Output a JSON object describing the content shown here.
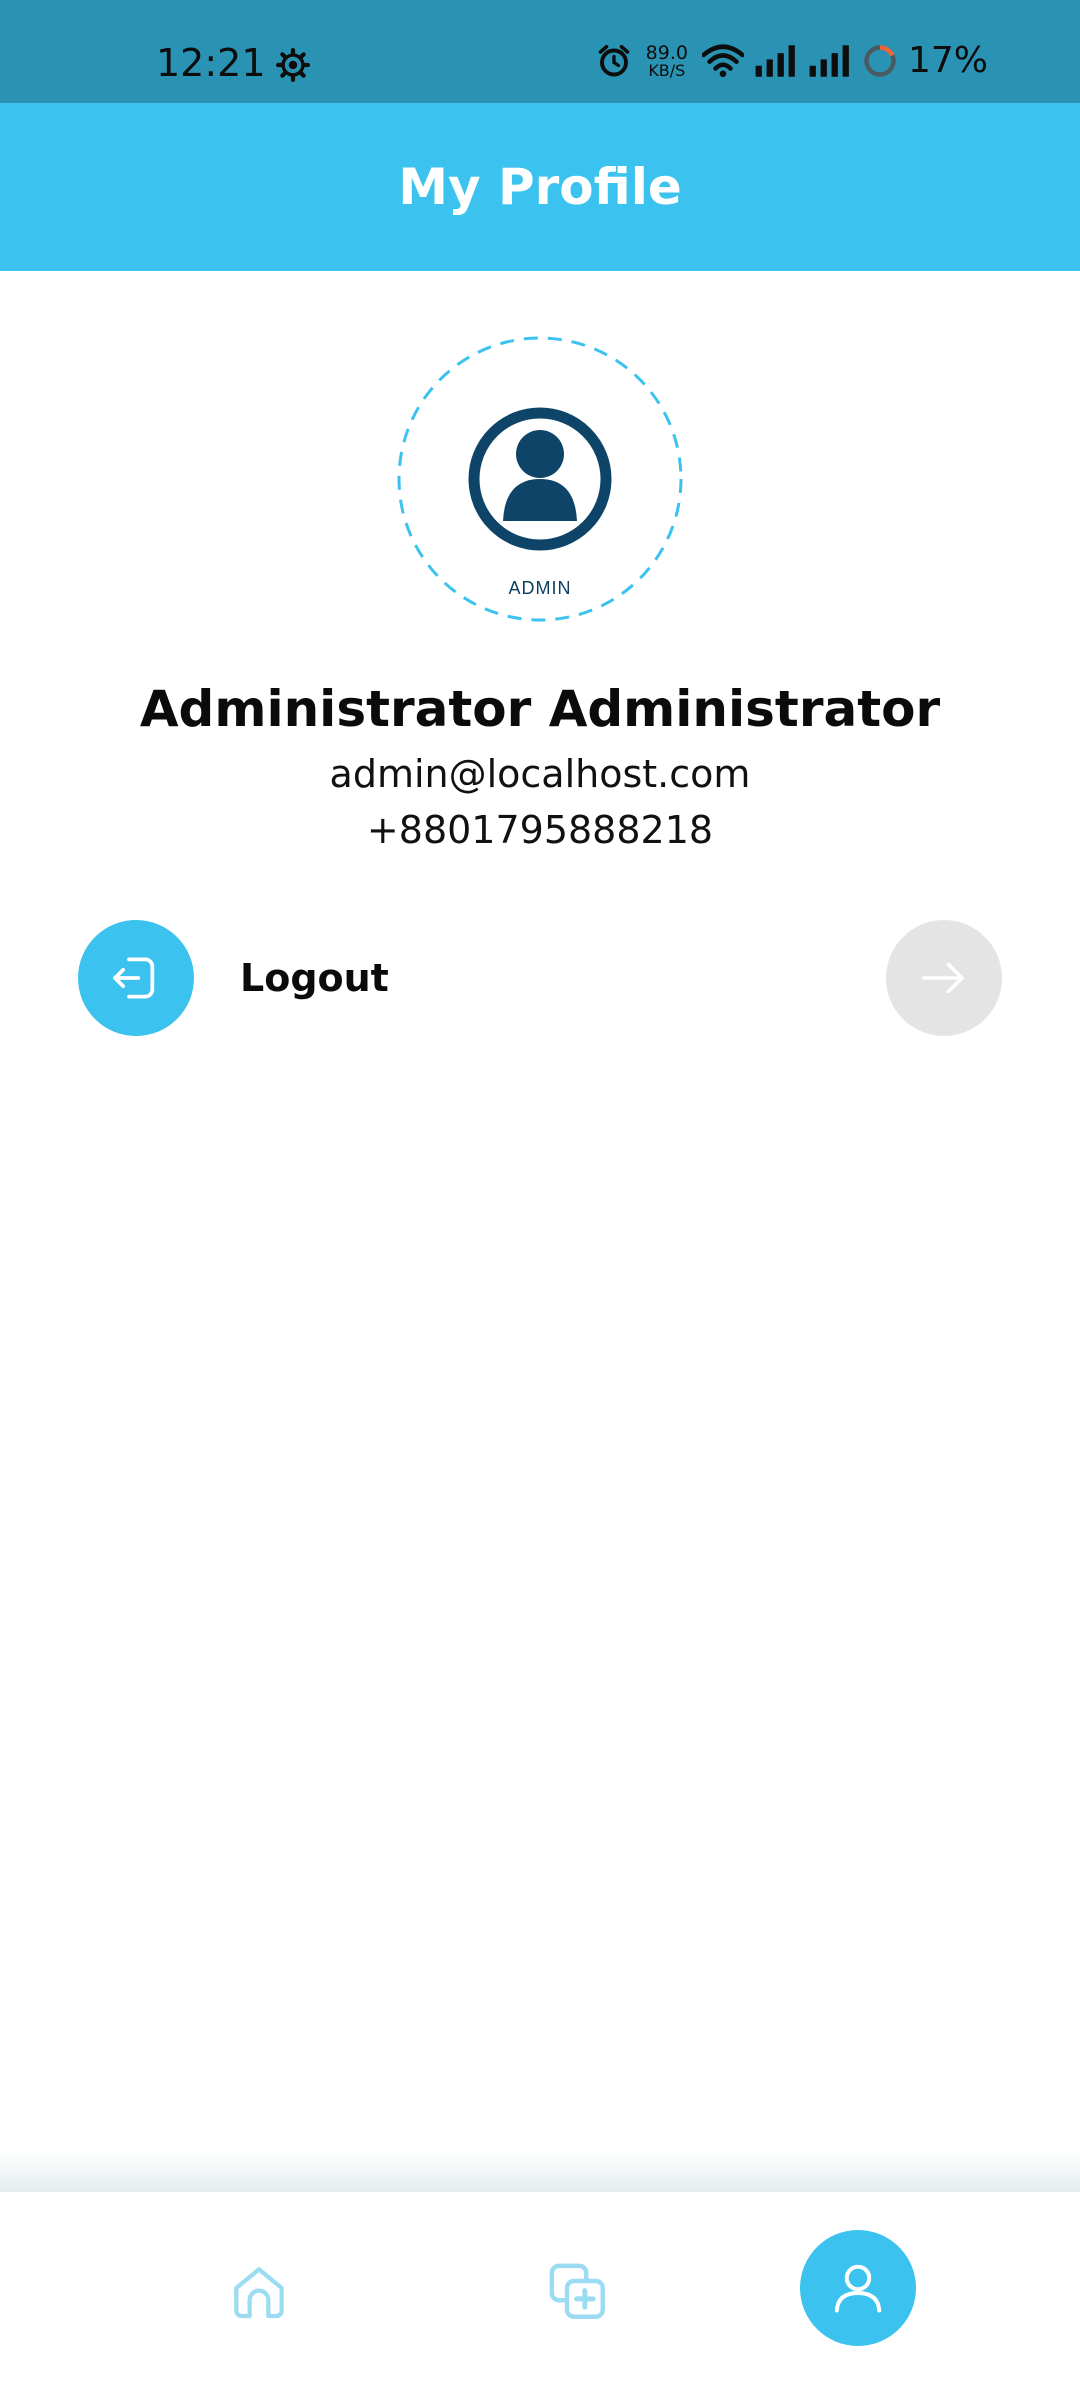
{
  "status_bar": {
    "time": "12:21",
    "net_speed_value": "89.0",
    "net_speed_unit": "KB/S",
    "battery": "17%"
  },
  "app_bar": {
    "title": "My Profile"
  },
  "profile": {
    "role_badge": "ADMIN",
    "name": "Administrator Administrator",
    "email": "admin@localhost.com",
    "phone": "+8801795888218"
  },
  "actions": {
    "logout_label": "Logout"
  },
  "bottom_nav": {
    "items": [
      {
        "icon": "home-icon",
        "active": false
      },
      {
        "icon": "add-copy-icon",
        "active": false
      },
      {
        "icon": "profile-icon",
        "active": true
      }
    ]
  },
  "colors": {
    "status_bar": "#2a93b4",
    "accent": "#3bc2ee",
    "avatar_dark": "#0e4468",
    "disabled_circle": "#e4e4e4"
  }
}
